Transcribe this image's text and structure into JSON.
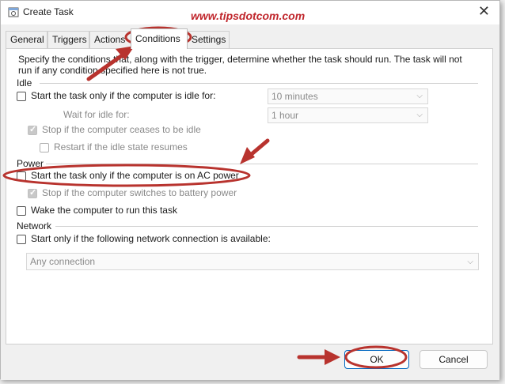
{
  "window": {
    "title": "Create Task"
  },
  "watermark": "www.tipsdotcom.com",
  "tabs": [
    "General",
    "Triggers",
    "Actions",
    "Conditions",
    "Settings"
  ],
  "active_tab": "Conditions",
  "description": {
    "line1": "Specify the conditions that, along with the trigger, determine whether the task should run.  The task will not",
    "line2": "run  if any condition specified here is not true."
  },
  "idle": {
    "section": "Idle",
    "start_only_if_idle": "Start the task only if the computer is idle for:",
    "idle_for_value": "10 minutes",
    "wait_for_idle_label": "Wait for idle for:",
    "wait_for_idle_value": "1 hour",
    "stop_if_ceases": "Stop if the computer ceases to be idle",
    "restart_if_resumes": "Restart if the idle state resumes"
  },
  "power": {
    "section": "Power",
    "ac_power": "Start the task only if the computer is on AC power",
    "stop_on_battery": "Stop if the computer switches to battery power",
    "wake": "Wake the computer to run this task"
  },
  "network": {
    "section": "Network",
    "start_if_network": "Start only if the following network connection is available:",
    "connection_value": "Any connection"
  },
  "buttons": {
    "ok": "OK",
    "cancel": "Cancel"
  },
  "colors": {
    "annotation_red": "#b8332e",
    "accent_blue": "#0067c0"
  }
}
